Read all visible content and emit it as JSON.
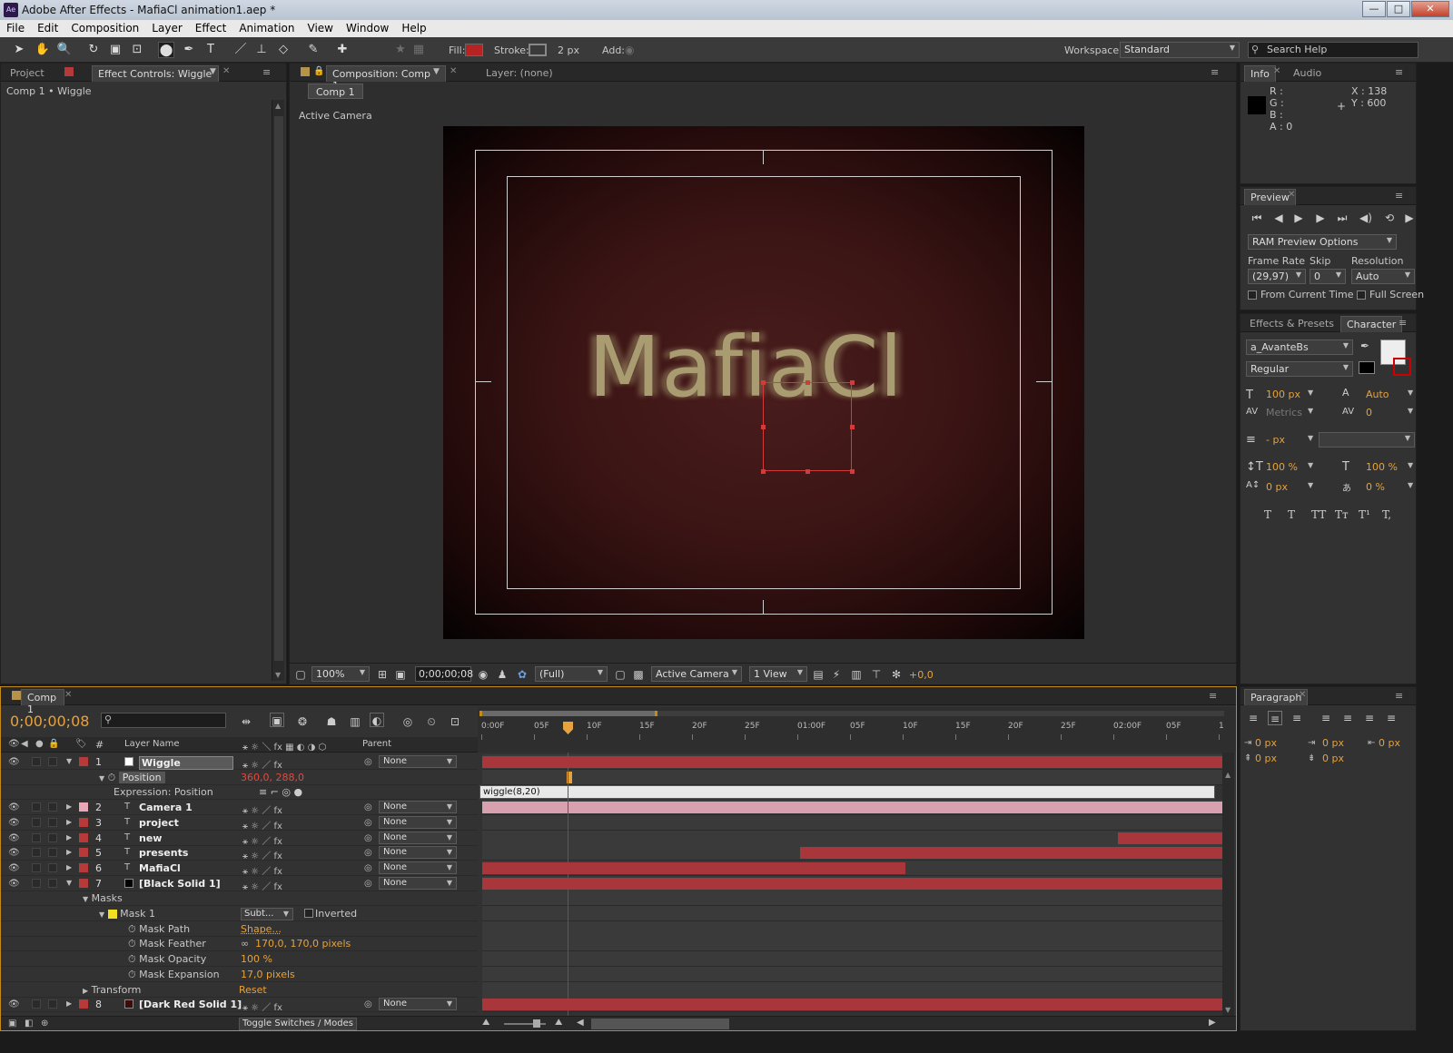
{
  "window": {
    "title": "Adobe After Effects - MafiaCl animation1.aep *",
    "app_icon": "Ae",
    "min": "—",
    "max": "□",
    "close": "✕"
  },
  "menu": [
    "File",
    "Edit",
    "Composition",
    "Layer",
    "Effect",
    "Animation",
    "View",
    "Window",
    "Help"
  ],
  "toolbar": {
    "fill_label": "Fill:",
    "stroke_label": "Stroke:",
    "stroke_width": "2 px",
    "add_label": "Add:",
    "workspace_label": "Workspace:",
    "workspace_value": "Standard",
    "search_placeholder": "Search Help",
    "fill_color": "#b52323"
  },
  "left_panel": {
    "tab_project": "Project",
    "tab_effect_controls": "Effect Controls: Wiggle",
    "breadcrumb": "Comp 1 • Wiggle"
  },
  "comp_panel": {
    "tab_comp": "Composition: Comp 1",
    "tab_layer": "Layer: (none)",
    "sub_tab": "Comp 1",
    "view_label": "Active Camera",
    "canvas_text": "MafiaCl",
    "zoom": "100%",
    "timecode": "0;00;00;08",
    "resolution": "(Full)",
    "camera": "Active Camera",
    "views": "1 View",
    "exposure": "+0,0"
  },
  "info_panel": {
    "tab_info": "Info",
    "tab_audio": "Audio",
    "r": "R :",
    "g": "G :",
    "b": "B :",
    "a": "A : 0",
    "x": "X : 138",
    "y": "Y : 600"
  },
  "preview_panel": {
    "tab": "Preview",
    "ram_options": "RAM Preview Options",
    "frame_rate_label": "Frame Rate",
    "skip_label": "Skip",
    "resolution_label": "Resolution",
    "frame_rate": "(29,97)",
    "skip": "0",
    "resolution": "Auto",
    "from_current": "From Current Time",
    "full_screen": "Full Screen"
  },
  "character_panel": {
    "tab_effects": "Effects & Presets",
    "tab_character": "Character",
    "font": "a_AvanteBs",
    "style": "Regular",
    "size": "100 px",
    "leading": "Auto",
    "kerning": "Metrics",
    "tracking": "0",
    "stroke_width": "- px",
    "vscale": "100 %",
    "hscale": "100 %",
    "baseline": "0 px",
    "tsume": "0 %",
    "styles": [
      "T",
      "T",
      "TT",
      "Tт",
      "T¹",
      "T,"
    ]
  },
  "paragraph_panel": {
    "tab": "Paragraph",
    "indent_left": "0 px",
    "indent_first": "0 px",
    "indent_right": "0 px",
    "space_before": "0 px",
    "space_after": "0 px"
  },
  "timeline": {
    "tab": "Comp 1",
    "timecode": "0;00;00;08",
    "col_hash": "#",
    "col_layer_name": "Layer Name",
    "col_parent": "Parent",
    "ruler": [
      "0:00F",
      "05F",
      "10F",
      "15F",
      "20F",
      "25F",
      "01:00F",
      "05F",
      "10F",
      "15F",
      "20F",
      "25F",
      "02:00F",
      "05F",
      "1"
    ],
    "expression": "wiggle(8,20)",
    "toggle": "Toggle Switches / Modes",
    "layers": [
      {
        "num": "1",
        "name": "Wiggle",
        "color": "#b73a3a",
        "swatch": "#ffffff",
        "parent": "None"
      },
      {
        "num": "2",
        "name": "Camera 1",
        "color": "#e8a8b8",
        "swatch": "",
        "parent": "None"
      },
      {
        "num": "3",
        "name": "project",
        "color": "#b73a3a",
        "swatch": "",
        "parent": "None"
      },
      {
        "num": "4",
        "name": "new",
        "color": "#b73a3a",
        "swatch": "",
        "parent": "None"
      },
      {
        "num": "5",
        "name": "presents",
        "color": "#b73a3a",
        "swatch": "",
        "parent": "None"
      },
      {
        "num": "6",
        "name": "MafiaCl",
        "color": "#b73a3a",
        "swatch": "",
        "parent": "None"
      },
      {
        "num": "7",
        "name": "[Black Solid 1]",
        "color": "#b73a3a",
        "swatch": "#000000",
        "parent": "None"
      },
      {
        "num": "8",
        "name": "[Dark Red Solid 1]",
        "color": "#b73a3a",
        "swatch": "#3a0d0d",
        "parent": "None"
      }
    ],
    "position_label": "Position",
    "position_value": "360,0, 288,0",
    "expr_label": "Expression: Position",
    "masks_label": "Masks",
    "mask1_label": "Mask 1",
    "mask_mode": "Subt...",
    "inverted": "Inverted",
    "mask_path": "Mask Path",
    "mask_path_val": "Shape...",
    "mask_feather": "Mask Feather",
    "mask_feather_val": "170,0, 170,0 pixels",
    "mask_opacity": "Mask Opacity",
    "mask_opacity_val": "100 %",
    "mask_expansion": "Mask Expansion",
    "mask_expansion_val": "17,0 pixels",
    "transform": "Transform",
    "transform_val": "Reset"
  }
}
